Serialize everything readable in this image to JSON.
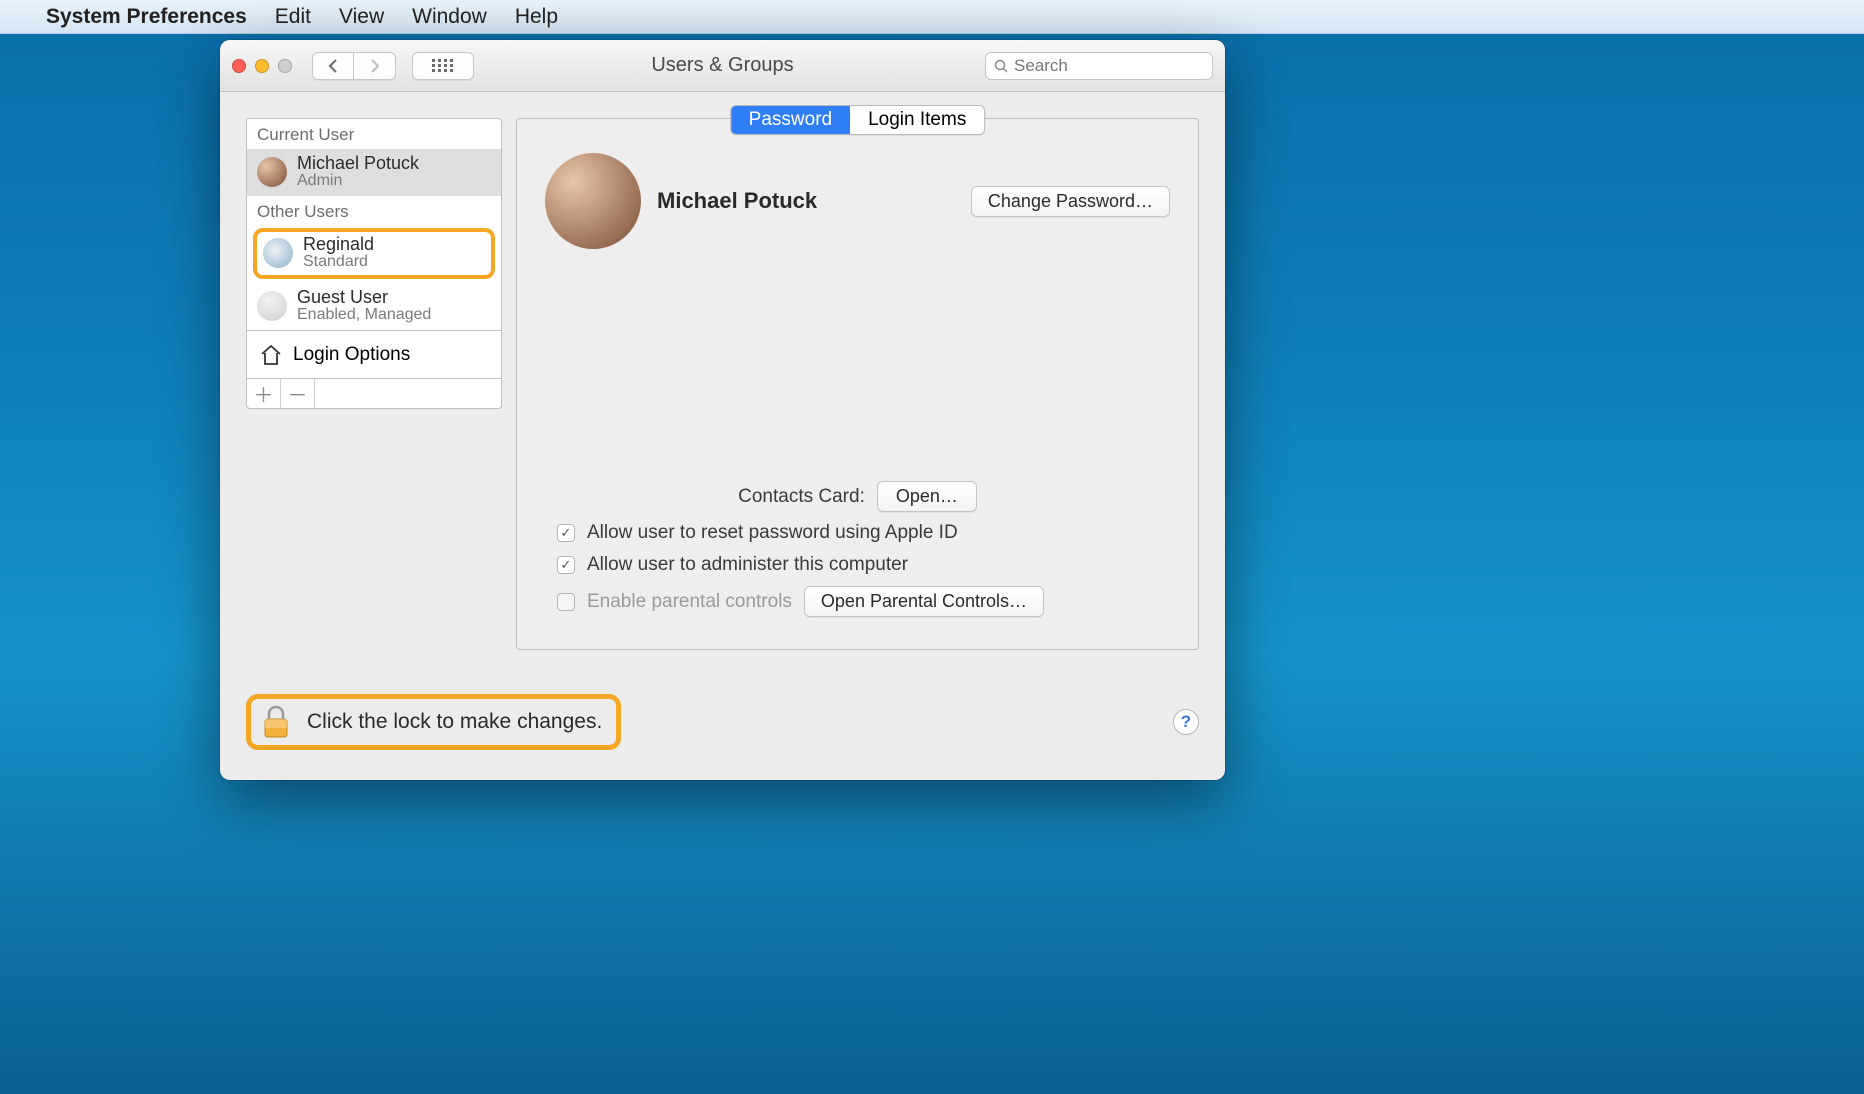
{
  "menubar": {
    "appname": "System Preferences",
    "items": [
      "Edit",
      "View",
      "Window",
      "Help"
    ]
  },
  "window": {
    "title": "Users & Groups",
    "search_placeholder": "Search"
  },
  "sidebar": {
    "current_user_label": "Current User",
    "other_users_label": "Other Users",
    "current_user": {
      "name": "Michael Potuck",
      "role": "Admin"
    },
    "other_users": [
      {
        "name": "Reginald",
        "role": "Standard",
        "highlighted": true
      },
      {
        "name": "Guest User",
        "role": "Enabled, Managed"
      }
    ],
    "login_options_label": "Login Options"
  },
  "tabs": {
    "password": "Password",
    "login_items": "Login Items",
    "active": "password"
  },
  "detail": {
    "user_name": "Michael Potuck",
    "change_password_btn": "Change Password…",
    "contacts_label": "Contacts Card:",
    "open_btn": "Open…",
    "allow_reset": "Allow user to reset password using Apple ID",
    "allow_admin": "Allow user to administer this computer",
    "parental_label": "Enable parental controls",
    "parental_btn": "Open Parental Controls…"
  },
  "footer": {
    "lock_text": "Click the lock to make changes.",
    "help": "?"
  }
}
